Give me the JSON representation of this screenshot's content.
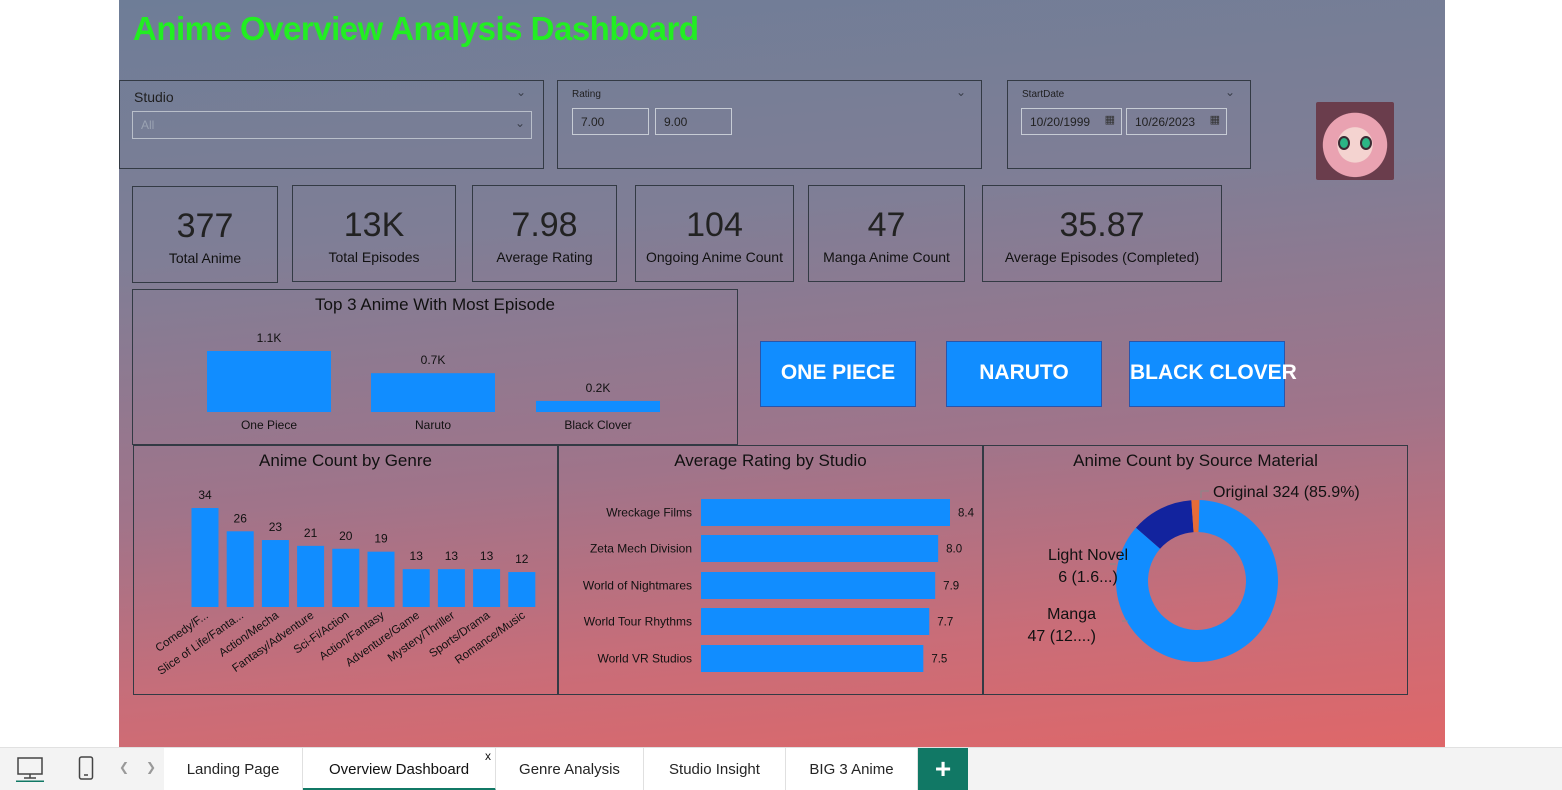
{
  "title": "Anime Overview Analysis Dashboard",
  "slicers": {
    "studio": {
      "label": "Studio",
      "value": "All"
    },
    "rating": {
      "label": "Rating",
      "min": "7.00",
      "max": "9.00"
    },
    "start_date": {
      "label": "StartDate",
      "from": "10/20/1999",
      "to": "10/26/2023"
    }
  },
  "kpis": [
    {
      "value": "377",
      "label": "Total Anime"
    },
    {
      "value": "13K",
      "label": "Total Episodes"
    },
    {
      "value": "7.98",
      "label": "Average Rating"
    },
    {
      "value": "104",
      "label": "Ongoing Anime Count"
    },
    {
      "value": "47",
      "label": "Manga Anime Count"
    },
    {
      "value": "35.87",
      "label": "Average Episodes (Completed)"
    }
  ],
  "big3_buttons": [
    "ONE PIECE",
    "NARUTO",
    "BLACK CLOVER"
  ],
  "colors": {
    "bar": "#118dff",
    "title": "#22ee22",
    "donut_original": "#118dff",
    "donut_manga": "#12239e",
    "donut_light_novel": "#e66c37",
    "tab_accent": "#117865"
  },
  "chart_data": [
    {
      "type": "bar",
      "title": "Top 3 Anime With Most Episode",
      "categories": [
        "One Piece",
        "Naruto",
        "Black Clover"
      ],
      "values": [
        1100,
        700,
        200
      ],
      "data_labels": [
        "1.1K",
        "0.7K",
        "0.2K"
      ]
    },
    {
      "type": "bar",
      "title": "Anime Count by Genre",
      "categories": [
        "Comedy/F...",
        "Slice of Life/Fanta...",
        "Action/Mecha",
        "Fantasy/Adventure",
        "Sci-Fi/Action",
        "Action/Fantasy",
        "Adventure/Game",
        "Mystery/Thriller",
        "Sports/Drama",
        "Romance/Music"
      ],
      "values": [
        34,
        26,
        23,
        21,
        20,
        19,
        13,
        13,
        13,
        12
      ]
    },
    {
      "type": "bar",
      "orientation": "horizontal",
      "title": "Average Rating by Studio",
      "categories": [
        "Wreckage Films",
        "Zeta Mech Division",
        "World of Nightmares",
        "World Tour Rhythms",
        "World VR Studios"
      ],
      "values": [
        8.4,
        8.0,
        7.9,
        7.7,
        7.5
      ]
    },
    {
      "type": "pie",
      "title": "Anime Count by Source Material",
      "slices": [
        {
          "name": "Original",
          "value": 324,
          "label": "Original 324 (85.9%)"
        },
        {
          "name": "Manga",
          "value": 47,
          "label_line1": "Manga",
          "label_line2": "47 (12....)"
        },
        {
          "name": "Light Novel",
          "value": 6,
          "label_line1": "Light Novel",
          "label_line2": "6 (1.6...)"
        }
      ]
    }
  ],
  "tabs": [
    {
      "label": "Landing Page",
      "active": false
    },
    {
      "label": "Overview Dashboard",
      "active": true
    },
    {
      "label": "Genre Analysis",
      "active": false
    },
    {
      "label": "Studio Insight",
      "active": false
    },
    {
      "label": "BIG 3 Anime",
      "active": false
    }
  ],
  "tab_close": "x",
  "add_tab": "+"
}
